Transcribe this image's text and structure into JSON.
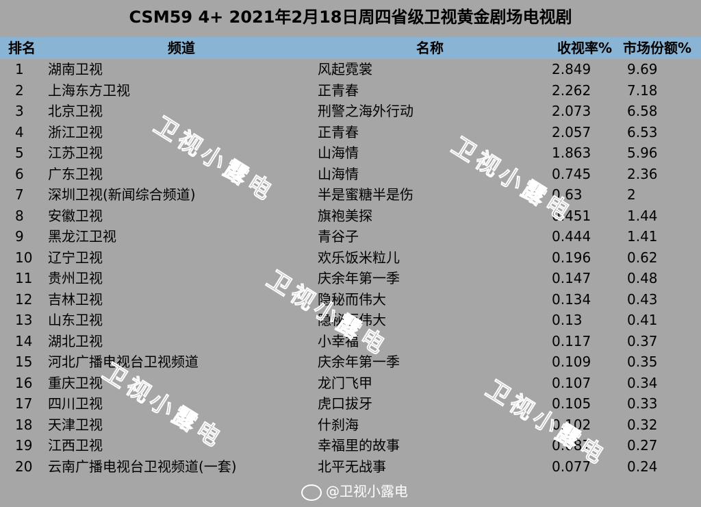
{
  "title": "CSM59 4+ 2021年2月18日周四省级卫视黄金剧场电视剧",
  "headers": {
    "rank": "排名",
    "channel": "频道",
    "show": "名称",
    "rating": "收视率%",
    "share": "市场份额%"
  },
  "rows": [
    {
      "rank": "1",
      "channel": "湖南卫视",
      "show": "风起霓裳",
      "rating": "2.849",
      "share": "9.69"
    },
    {
      "rank": "2",
      "channel": "上海东方卫视",
      "show": "正青春",
      "rating": "2.262",
      "share": "7.18"
    },
    {
      "rank": "3",
      "channel": "北京卫视",
      "show": "刑警之海外行动",
      "rating": "2.073",
      "share": "6.58"
    },
    {
      "rank": "4",
      "channel": "浙江卫视",
      "show": "正青春",
      "rating": "2.057",
      "share": "6.53"
    },
    {
      "rank": "5",
      "channel": "江苏卫视",
      "show": "山海情",
      "rating": "1.863",
      "share": "5.96"
    },
    {
      "rank": "6",
      "channel": "广东卫视",
      "show": "山海情",
      "rating": "0.745",
      "share": "2.36"
    },
    {
      "rank": "7",
      "channel": "深圳卫视(新闻综合频道)",
      "show": "半是蜜糖半是伤",
      "rating": "0.63",
      "share": "2"
    },
    {
      "rank": "8",
      "channel": "安徽卫视",
      "show": "旗袍美探",
      "rating": "0.451",
      "share": "1.44"
    },
    {
      "rank": "9",
      "channel": "黑龙江卫视",
      "show": "青谷子",
      "rating": "0.444",
      "share": "1.41"
    },
    {
      "rank": "10",
      "channel": "辽宁卫视",
      "show": "欢乐饭米粒儿",
      "rating": "0.196",
      "share": "0.62"
    },
    {
      "rank": "11",
      "channel": "贵州卫视",
      "show": "庆余年第一季",
      "rating": "0.147",
      "share": "0.48"
    },
    {
      "rank": "12",
      "channel": "吉林卫视",
      "show": "隐秘而伟大",
      "rating": "0.134",
      "share": "0.43"
    },
    {
      "rank": "13",
      "channel": "山东卫视",
      "show": "隐秘而伟大",
      "rating": "0.13",
      "share": "0.41"
    },
    {
      "rank": "14",
      "channel": "湖北卫视",
      "show": "小幸福",
      "rating": "0.117",
      "share": "0.37"
    },
    {
      "rank": "15",
      "channel": "河北广播电视台卫视频道",
      "show": "庆余年第一季",
      "rating": "0.109",
      "share": "0.35"
    },
    {
      "rank": "16",
      "channel": "重庆卫视",
      "show": "龙门飞甲",
      "rating": "0.107",
      "share": "0.34"
    },
    {
      "rank": "17",
      "channel": "四川卫视",
      "show": "虎口拔牙",
      "rating": "0.105",
      "share": "0.33"
    },
    {
      "rank": "18",
      "channel": "天津卫视",
      "show": "什刹海",
      "rating": "0.102",
      "share": "0.32"
    },
    {
      "rank": "19",
      "channel": "江西卫视",
      "show": "幸福里的故事",
      "rating": "0.087",
      "share": "0.27"
    },
    {
      "rank": "20",
      "channel": "云南广播电视台卫视频道(一套)",
      "show": "北平无战事",
      "rating": "0.077",
      "share": "0.24"
    }
  ],
  "watermark": "卫视小露电",
  "footer": {
    "text": "@卫视小露电"
  },
  "colors": {
    "background": "#a6a6a6",
    "header": "#8ab4d4"
  }
}
